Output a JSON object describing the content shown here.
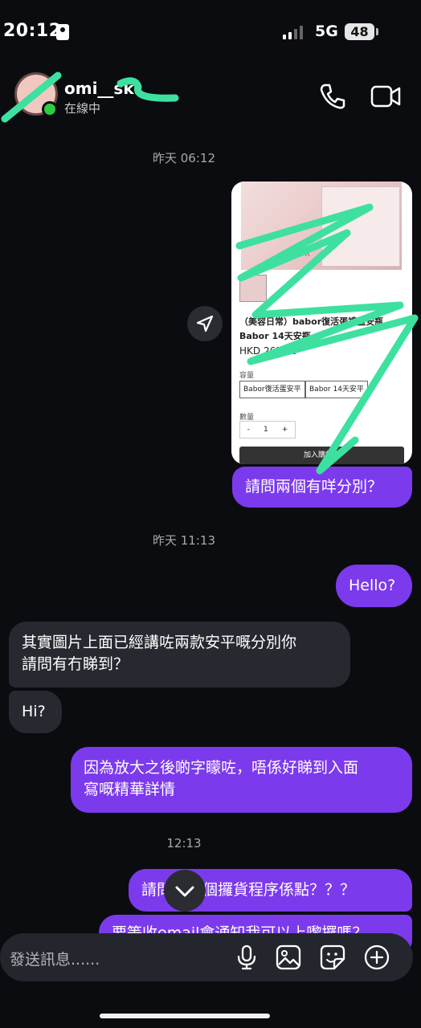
{
  "status_bar": {
    "time": "20:12",
    "network": "5G",
    "battery": "48"
  },
  "header": {
    "name": "omi__ski",
    "status": "在線中"
  },
  "timestamps": [
    "昨天 06:12",
    "昨天 11:13",
    "12:13"
  ],
  "product_card": {
    "title": "（美容日常）babor復活蛋禮盒安瓶 Babor 14天安瓶",
    "price": "HKD 265.00",
    "option_label": "容量",
    "options": [
      "Babor復活蛋安平",
      "Babor 14天安平"
    ],
    "qty_label": "數量",
    "qty": "1",
    "qty_minus": "-",
    "qty_plus": "+",
    "cart_label": "加入購物車",
    "brand": "BABOR"
  },
  "messages": {
    "m1": "請問兩個有咩分別？",
    "m2": "Hello?",
    "m3_line1": "其實圖片上面已經講咗兩款安平嘅分別你",
    "m3_line2": "請問有冇睇到？",
    "m4": "Hi?",
    "m5_line1": "因為放大之後啲字矇咗，唔係好睇到入面",
    "m5_line2": "寫嘅精華詳情",
    "m6": "請問下單個攞貨程序係點？？？",
    "m7": "要等收email會通知我可以上嚟攞嗎？"
  },
  "composer": {
    "placeholder": "發送訊息......"
  },
  "icons": [
    "id-card-icon",
    "signal-icon",
    "phone-icon",
    "video-icon",
    "send-icon",
    "chevron-down-icon",
    "mic-icon",
    "image-icon",
    "sticker-icon",
    "plus-icon"
  ],
  "colors": {
    "background": "#0b0c10",
    "outgoing": "#7c3aed",
    "incoming": "#262a30",
    "scribble": "#3ee0a0"
  }
}
